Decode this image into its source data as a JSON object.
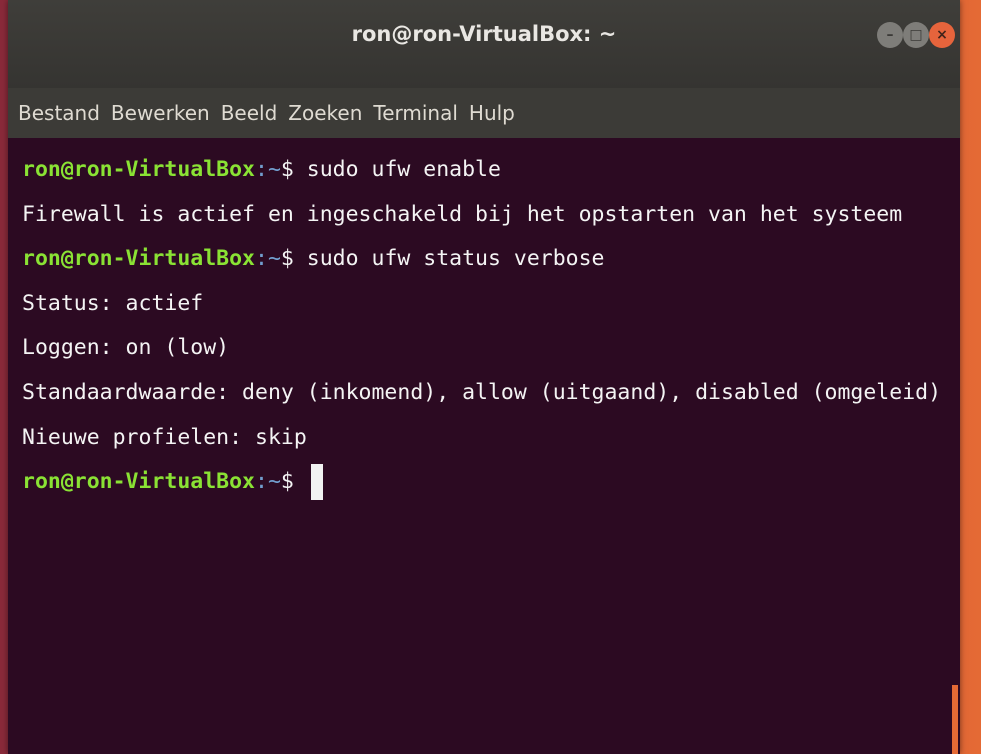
{
  "window": {
    "title": "ron@ron-VirtualBox: ~",
    "minimize_symbol": "–",
    "maximize_symbol": "□",
    "close_symbol": "×"
  },
  "menu": [
    "Bestand",
    "Bewerken",
    "Beeld",
    "Zoeken",
    "Terminal",
    "Hulp"
  ],
  "terminal": {
    "prompt_user": "ron@ron-VirtualBox",
    "prompt_dir": ":~",
    "prompt_symbol": "$ ",
    "lines": [
      {
        "type": "cmd",
        "text": "sudo ufw enable"
      },
      {
        "type": "out",
        "text": "Firewall is actief en ingeschakeld bij het opstarten van het systeem"
      },
      {
        "type": "cmd",
        "text": "sudo ufw status verbose"
      },
      {
        "type": "out",
        "text": "Status: actief"
      },
      {
        "type": "out",
        "text": "Loggen: on (low)"
      },
      {
        "type": "out",
        "text": "Standaardwaarde: deny (inkomend), allow (uitgaand), disabled (omgeleid)"
      },
      {
        "type": "out",
        "text": "Nieuwe profielen: skip"
      },
      {
        "type": "cmd",
        "text": ""
      }
    ]
  },
  "colors": {
    "terminal_bg": "#2c0a22",
    "prompt_user": "#8ae234",
    "prompt_dir": "#729fcf",
    "text": "#f4f4f4",
    "close_button": "#e6643c"
  }
}
